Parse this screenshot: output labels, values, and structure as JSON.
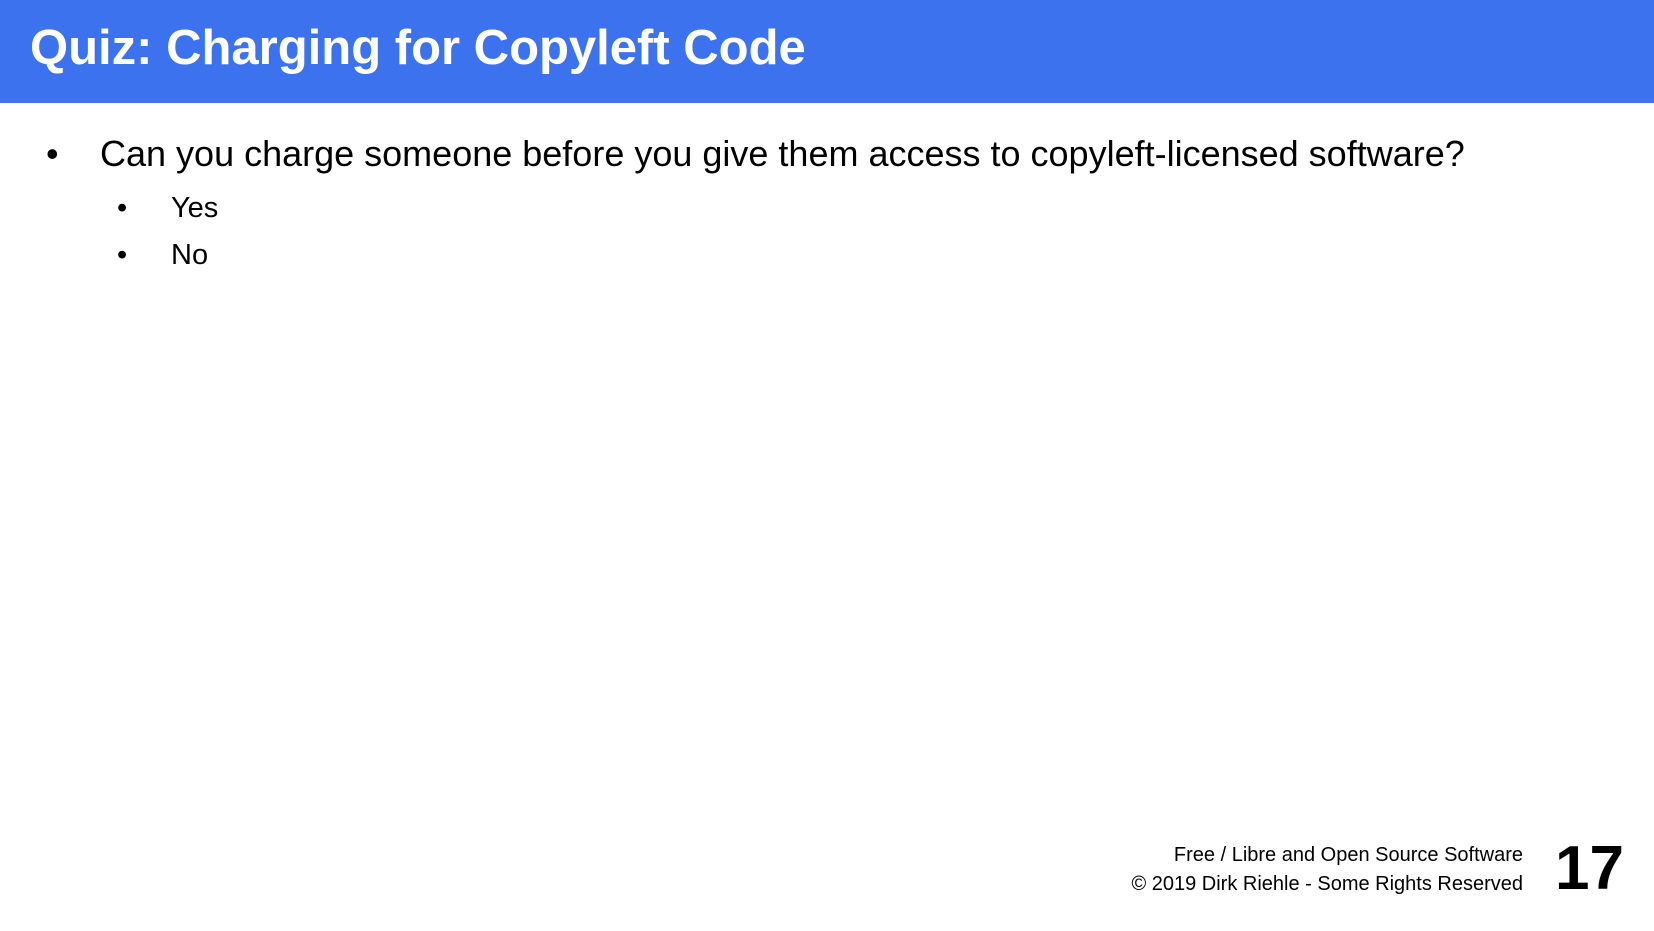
{
  "slide": {
    "title": "Quiz: Charging for Copyleft Code",
    "bullets": [
      {
        "text": "Can you charge someone before you give them access to copyleft-licensed software?",
        "glyph": "•",
        "sub_bullets": [
          {
            "text": "Yes",
            "glyph": "•"
          },
          {
            "text": "No",
            "glyph": "•"
          }
        ]
      }
    ]
  },
  "footer": {
    "line1": "Free / Libre and Open Source Software",
    "line2": "© 2019 Dirk Riehle - Some Rights Reserved",
    "page_number": "17"
  },
  "colors": {
    "title_bar": "#3c72ee",
    "title_text": "#ffffff",
    "body_text": "#000000",
    "background": "#ffffff"
  }
}
